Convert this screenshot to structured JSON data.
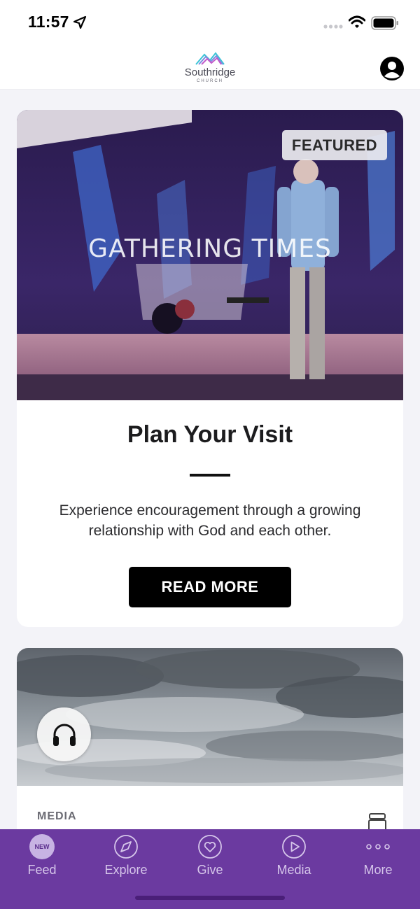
{
  "status_bar": {
    "time": "11:57",
    "icons": [
      "location-arrow-icon",
      "signal-icon",
      "wifi-icon",
      "battery-icon"
    ]
  },
  "header": {
    "logo_name": "Southridge",
    "logo_sub": "CHURCH",
    "profile_icon": "profile-icon"
  },
  "featured_card": {
    "badge": "FEATURED",
    "image_text": "GATHERING TIMES",
    "title": "Plan Your Visit",
    "description": "Experience encouragement through a growing relationship with God and each other.",
    "button": "READ MORE"
  },
  "media_card": {
    "label": "MEDIA",
    "play_icon": "headphones-icon",
    "type_icon": "media-stack-icon"
  },
  "tab_bar": {
    "accent": "#6b3aa0",
    "tabs": [
      {
        "label": "Feed",
        "badge": "NEW",
        "icon": "new-badge-icon"
      },
      {
        "label": "Explore",
        "icon": "compass-icon"
      },
      {
        "label": "Give",
        "icon": "heart-icon"
      },
      {
        "label": "Media",
        "icon": "play-icon"
      },
      {
        "label": "More",
        "icon": "more-dots-icon"
      }
    ]
  }
}
